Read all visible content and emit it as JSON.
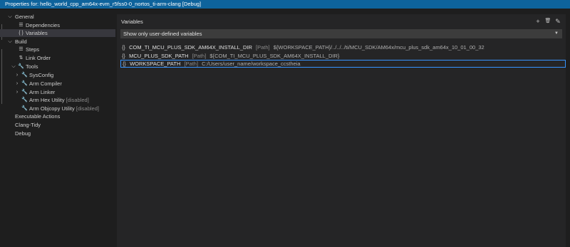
{
  "window": {
    "title": "Properties for: hello_world_cpp_am64x-evm_r5fss0-0_nortos_ti-arm-clang [Debug]"
  },
  "sidebar": {
    "items": [
      {
        "label": "General",
        "expanded": true,
        "icon": "none"
      },
      {
        "label": "Dependencies",
        "icon": "list-icon"
      },
      {
        "label": "Variables",
        "icon": "variable-icon",
        "selected": true
      },
      {
        "label": "Build",
        "expanded": true,
        "icon": "none"
      },
      {
        "label": "Steps",
        "icon": "list-icon"
      },
      {
        "label": "Link Order",
        "icon": "sort-icon"
      },
      {
        "label": "Tools",
        "expanded": true,
        "icon": "wrench-icon"
      },
      {
        "label": "SysConfig",
        "collapsed": true,
        "icon": "wrench-icon"
      },
      {
        "label": "Arm Compiler",
        "collapsed": true,
        "icon": "wrench-icon"
      },
      {
        "label": "Arm Linker",
        "collapsed": true,
        "icon": "wrench-icon"
      },
      {
        "label": "Arm Hex Utility",
        "note": "[disabled]",
        "icon": "wrench-icon"
      },
      {
        "label": "Arm Objcopy Utility",
        "note": "[disabled]",
        "icon": "wrench-icon"
      },
      {
        "label": "Executable Actions"
      },
      {
        "label": "Clang-Tidy"
      },
      {
        "label": "Debug"
      }
    ]
  },
  "main": {
    "title": "Variables",
    "actions": [
      {
        "icon": "add-icon",
        "glyph": "+"
      },
      {
        "icon": "delete-icon",
        "glyph": "🗑"
      },
      {
        "icon": "edit-icon",
        "glyph": "✎"
      }
    ],
    "filter": "Show only user-defined variables",
    "variables": [
      {
        "name": "COM_TI_MCU_PLUS_SDK_AM64X_INSTALL_DIR",
        "type": "[Path]",
        "value": "${WORKSPACE_PATH}/../../../ti/MCU_SDK/AM64x/mcu_plus_sdk_am64x_10_01_00_32"
      },
      {
        "name": "MCU_PLUS_SDK_PATH",
        "type": "[Path]",
        "value": "${COM_TI_MCU_PLUS_SDK_AM64X_INSTALL_DIR}"
      },
      {
        "name": "WORKSPACE_PATH",
        "type": "[Path]",
        "value": "C:/Users/user_name/workspace_ccstheia",
        "focused": true
      }
    ]
  }
}
